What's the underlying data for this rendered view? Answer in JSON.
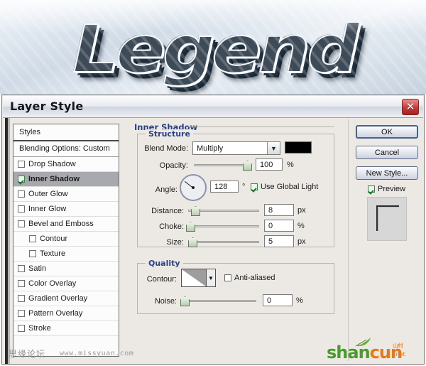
{
  "banner": {
    "word": "Legend",
    "alt": "chrome-metal-3d-text-legend"
  },
  "dialog": {
    "title": "Layer Style",
    "close_label": "✕"
  },
  "styles_panel": {
    "header": "Styles",
    "blending_options": "Blending Options: Custom",
    "effects": [
      {
        "label": "Drop Shadow",
        "checked": false,
        "indent": false,
        "selected": false
      },
      {
        "label": "Inner Shadow",
        "checked": true,
        "indent": false,
        "selected": true
      },
      {
        "label": "Outer Glow",
        "checked": false,
        "indent": false,
        "selected": false
      },
      {
        "label": "Inner Glow",
        "checked": false,
        "indent": false,
        "selected": false
      },
      {
        "label": "Bevel and Emboss",
        "checked": false,
        "indent": false,
        "selected": false
      },
      {
        "label": "Contour",
        "checked": false,
        "indent": true,
        "selected": false
      },
      {
        "label": "Texture",
        "checked": false,
        "indent": true,
        "selected": false
      },
      {
        "label": "Satin",
        "checked": false,
        "indent": false,
        "selected": false
      },
      {
        "label": "Color Overlay",
        "checked": false,
        "indent": false,
        "selected": false
      },
      {
        "label": "Gradient Overlay",
        "checked": false,
        "indent": false,
        "selected": false
      },
      {
        "label": "Pattern Overlay",
        "checked": false,
        "indent": false,
        "selected": false
      },
      {
        "label": "Stroke",
        "checked": false,
        "indent": false,
        "selected": false
      }
    ]
  },
  "main": {
    "section_title": "Inner Shadow",
    "structure": {
      "group_label": "Structure",
      "blend_mode_label": "Blend Mode:",
      "blend_mode_value": "Multiply",
      "blend_color": "#000000",
      "opacity_label": "Opacity:",
      "opacity_value": "100",
      "opacity_unit": "%",
      "angle_label": "Angle:",
      "angle_value": "128",
      "angle_unit": "°",
      "use_global_light": "Use Global Light",
      "use_global_light_checked": true,
      "distance_label": "Distance:",
      "distance_value": "8",
      "distance_unit": "px",
      "choke_label": "Choke:",
      "choke_value": "0",
      "choke_unit": "%",
      "size_label": "Size:",
      "size_value": "5",
      "size_unit": "px"
    },
    "quality": {
      "group_label": "Quality",
      "contour_label": "Contour:",
      "anti_aliased_label": "Anti-aliased",
      "anti_aliased_checked": false,
      "noise_label": "Noise:",
      "noise_value": "0",
      "noise_unit": "%"
    }
  },
  "right": {
    "ok": "OK",
    "cancel": "Cancel",
    "new_style": "New Style...",
    "preview_label": "Preview",
    "preview_checked": true
  },
  "watermarks": {
    "forum_cn": "思缘论坛",
    "forum_url": "www.missyuan.com",
    "logo_a": "shan",
    "logo_b": "cun",
    "logo_cn": "山村",
    "logo_tld": ".net"
  },
  "colors": {
    "accent_blue": "#2a3f86",
    "selection_gray": "#a7a9ae",
    "dialog_bg": "#ece9e4",
    "close_red": "#c33b3b",
    "logo_green": "#4a9b2f",
    "logo_orange": "#e8791a"
  }
}
